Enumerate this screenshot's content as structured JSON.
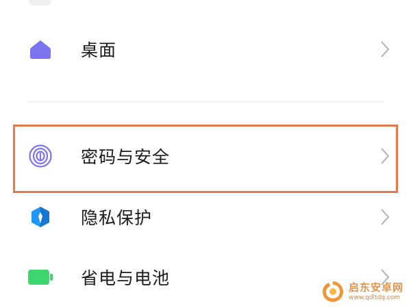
{
  "settings": {
    "items": [
      {
        "label": "桌面",
        "icon": "home-icon",
        "icon_color": "#7b73f0"
      },
      {
        "label": "密码与安全",
        "icon": "fingerprint-icon",
        "icon_color": "#7b73f0"
      },
      {
        "label": "隐私保护",
        "icon": "privacy-shield-icon",
        "icon_color": "#2196f3"
      },
      {
        "label": "省电与电池",
        "icon": "battery-icon",
        "icon_color": "#3dd66e"
      }
    ],
    "highlight_color": "#e5784d"
  },
  "watermark": {
    "text": "启东安卓网",
    "url": "www.qdltdq.com"
  }
}
